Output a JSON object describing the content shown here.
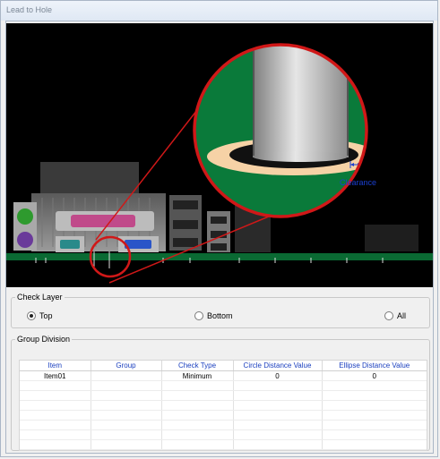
{
  "window": {
    "title": "Lead to Hole"
  },
  "illustration": {
    "annotation": "Clearance"
  },
  "check_layer": {
    "legend": "Check Layer",
    "options": [
      {
        "label": "Top",
        "selected": true
      },
      {
        "label": "Bottom",
        "selected": false
      },
      {
        "label": "All",
        "selected": false
      }
    ]
  },
  "group_division": {
    "legend": "Group Division",
    "columns": [
      "Item",
      "Group",
      "Check Type",
      "Circle Distance Value",
      "Ellipse Distance Value"
    ],
    "rows": [
      [
        "Item01",
        "",
        "Minimum",
        "0",
        "0"
      ]
    ]
  },
  "colors": {
    "header_text": "#1a3fbf",
    "pcb_green": "#0a7a3a",
    "lens_red": "#d01818",
    "clearance_blue": "#1a3fd0"
  }
}
